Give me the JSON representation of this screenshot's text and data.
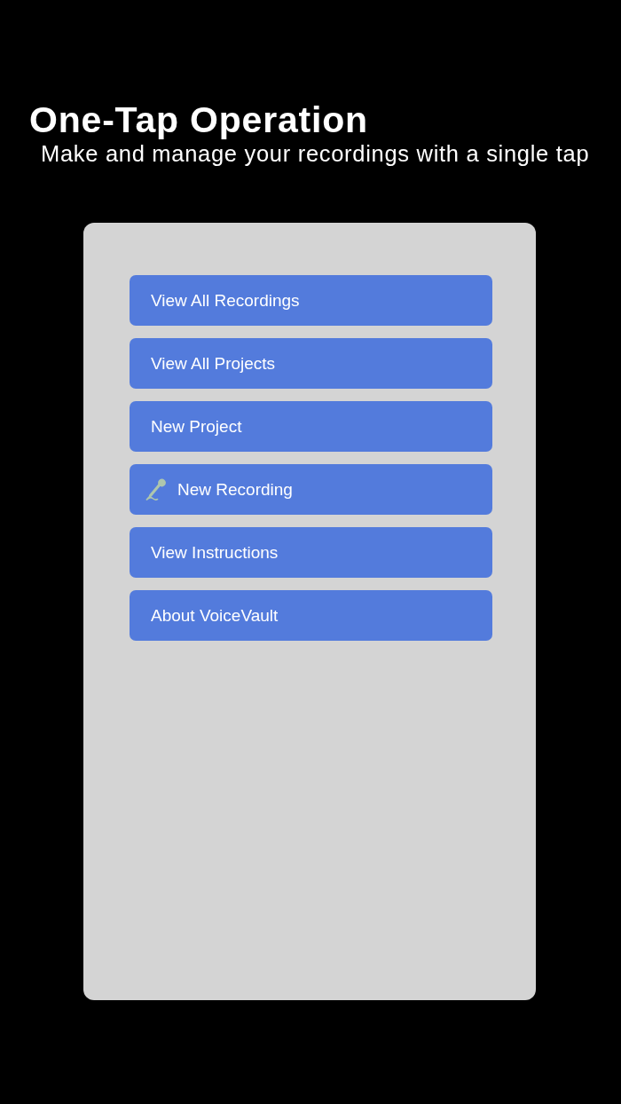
{
  "header": {
    "title": "One-Tap Operation",
    "subtitle": "Make and manage your recordings with a single tap"
  },
  "menu": {
    "items": [
      {
        "kind": "plain",
        "label": "View All Recordings"
      },
      {
        "kind": "plain",
        "label": "View All Projects"
      },
      {
        "kind": "plain",
        "label": "New Project"
      },
      {
        "kind": "microphone",
        "label": "New Recording"
      },
      {
        "kind": "plain",
        "label": "View Instructions"
      },
      {
        "kind": "plain",
        "label": "About VoiceVault"
      }
    ]
  }
}
